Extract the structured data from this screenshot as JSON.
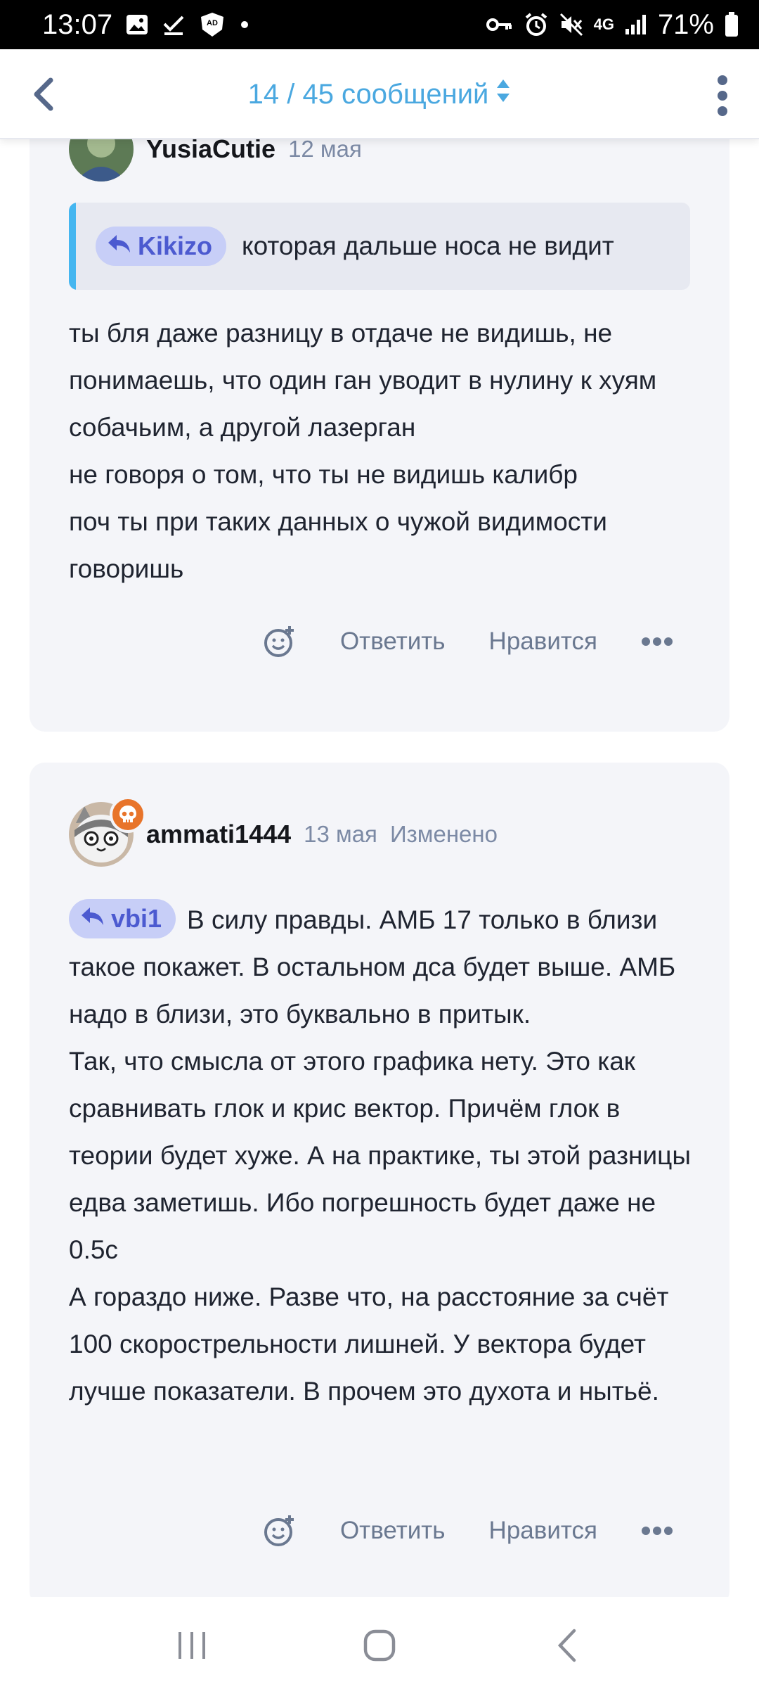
{
  "status_bar": {
    "time": "13:07",
    "network": "4G",
    "battery": "71%",
    "icons": [
      "image-icon",
      "check-icon",
      "adblocker-icon",
      "dot-icon",
      "key-icon",
      "alarm-icon",
      "mute-icon",
      "signal-icon",
      "battery-icon"
    ],
    "adblocker_label": "AD BLOCKER"
  },
  "header": {
    "title": "14 / 45 сообщений"
  },
  "posts": [
    {
      "author": "YusiaCutie",
      "date": "12 мая",
      "quote": {
        "mention": "Kikizo",
        "text": "которая дальше носа не видит"
      },
      "text": "ты бля даже разницу в отдаче не видишь, не понимаешь, что один ган уводит в нулину к хуям собачьим, а другой лазерган\nне говоря о том, что ты не видишь калибр\nпоч ты при таких данных о чужой видимости говоришь",
      "actions": {
        "reply": "Ответить",
        "like": "Нравится"
      }
    },
    {
      "author": "ammati1444",
      "date": "13 мая",
      "edited": "Изменено",
      "mention": "vbi1",
      "text": "В силу правды. АМБ 17 только в близи такое покажет. В остальном дса будет выше. АМБ надо в близи, это буквально в притык.\nТак, что смысла от этого графика нету. Это как сравнивать глок и крис вектор. Причём глок в теории будет хуже. А на практике, ты этой разницы едва заметишь. Ибо погрешность будет даже не 0.5с\nА гораздо ниже. Разве что, на расстояние за счёт 100 скорострельности лишней. У вектора будет лучше показатели. В прочем это духота и нытьё.",
      "actions": {
        "reply": "Ответить",
        "like": "Нравится"
      }
    }
  ],
  "colors": {
    "accent": "#4aa8e0",
    "mention_bg": "#c7cef7",
    "mention_text": "#4c5ad0",
    "card_bg": "#f4f5f9",
    "quote_bar": "#45b6f0",
    "badge": "#e8742a"
  }
}
